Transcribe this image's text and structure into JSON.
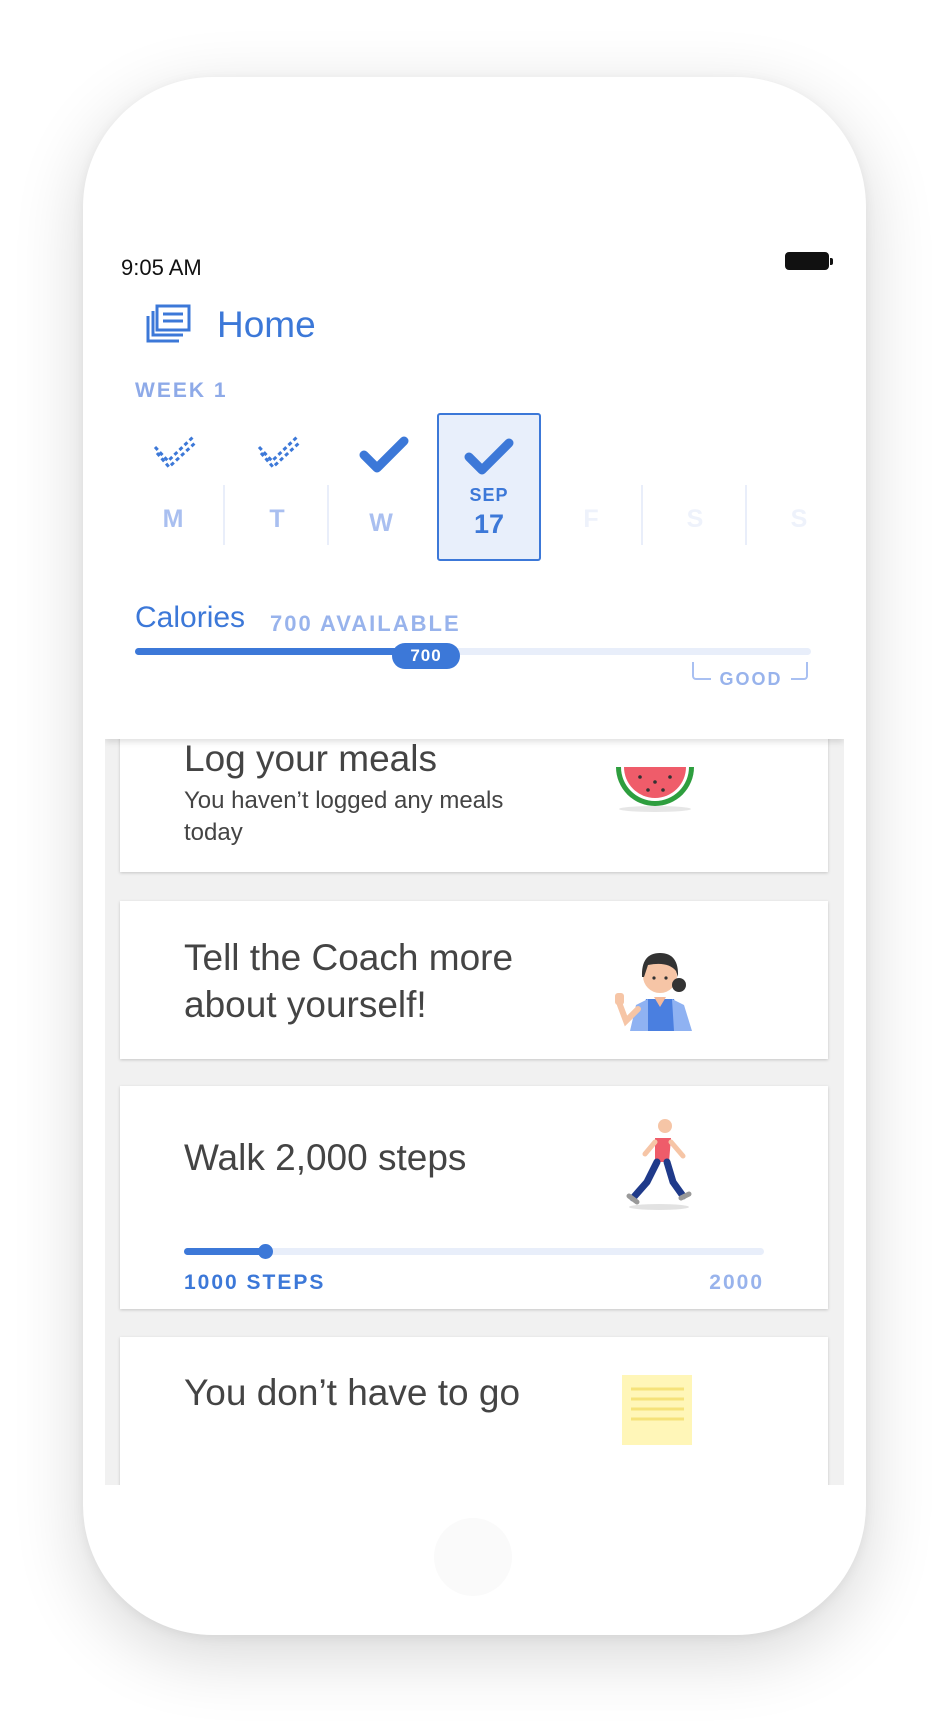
{
  "status_bar": {
    "time": "9:05 AM"
  },
  "header": {
    "title": "Home"
  },
  "week": {
    "label": "WEEK 1",
    "days": [
      {
        "letter": "M",
        "state": "partial"
      },
      {
        "letter": "T",
        "state": "partial"
      },
      {
        "letter": "W",
        "state": "complete"
      },
      {
        "month": "SEP",
        "date": "17",
        "state": "selected"
      },
      {
        "letter": "F",
        "state": "future"
      },
      {
        "letter": "S",
        "state": "future"
      },
      {
        "letter": "S",
        "state": "future"
      }
    ]
  },
  "calories": {
    "label": "Calories",
    "available": "700 AVAILABLE",
    "value": "700",
    "progress_fraction": 0.47,
    "range_label": "GOOD"
  },
  "cards": {
    "meals": {
      "title": "Log your meals",
      "subtitle": "You haven’t logged any meals today"
    },
    "coach": {
      "title": "Tell the Coach more about yourself!"
    },
    "steps": {
      "title": "Walk 2,000 steps",
      "current_label": "1000 STEPS",
      "goal_label": "2000",
      "progress_fraction": 0.14
    },
    "tip": {
      "title": "You don’t have to go"
    }
  },
  "colors": {
    "accent": "#3c78d8",
    "accent_light": "#98b3ec",
    "track": "#e8eefa"
  }
}
